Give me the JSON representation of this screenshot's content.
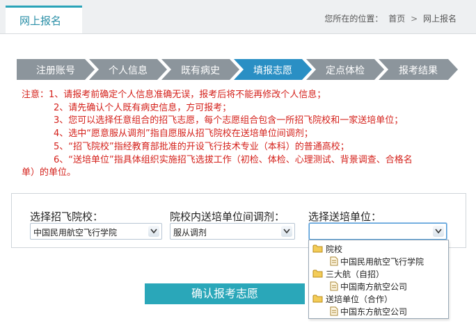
{
  "header": {
    "tab_title": "网上报名",
    "breadcrumb": {
      "prefix": "您所在的位置：",
      "items": [
        "首页",
        "网上报名"
      ],
      "separator": ">"
    }
  },
  "steps": [
    {
      "label": "注册账号",
      "active": false
    },
    {
      "label": "个人信息",
      "active": false
    },
    {
      "label": "既有病史",
      "active": false
    },
    {
      "label": "填报志愿",
      "active": true
    },
    {
      "label": "定点体检",
      "active": false
    },
    {
      "label": "报考结果",
      "active": false
    }
  ],
  "notes": {
    "prefix": "注意：",
    "items": [
      "1、请报考前确定个人信息准确无误，报考后将不能再修改个人信息；",
      "2、请先确认个人既有病史信息，方可报考；",
      "3、您可以选择任意组合的招飞志愿，每个志愿组合包含一所招飞院校和一家送培单位；",
      "4、选中“愿意服从调剂”指自愿服从招飞院校在送培单位间调剂；",
      "5、“招飞院校”指经教育部批准的开设飞行技术专业（本科）的普通高校；",
      "6、“送培单位”指具体组织实施招飞选拔工作（初检、体检、心理测试、背景调查、合格名"
    ],
    "continuation": "单）的单位。"
  },
  "form": {
    "school": {
      "label": "选择招飞院校：",
      "value": "中国民用航空飞行学院"
    },
    "adjust": {
      "label": "院校内送培单位间调剂：",
      "value": "服从调剂"
    },
    "unit": {
      "label": "选择送培单位：",
      "value": ""
    }
  },
  "dropdown": {
    "groups": [
      {
        "name": "院校",
        "items": [
          "中国民用航空飞行学院"
        ]
      },
      {
        "name": "三大航（自招）",
        "items": [
          "中国南方航空公司"
        ]
      },
      {
        "name": "送培单位（合作）",
        "items": [
          "中国东方航空公司"
        ]
      }
    ]
  },
  "confirm_label": "确认报考志愿",
  "colors": {
    "accent": "#29a3b8",
    "step_inactive": "#8c959c",
    "step_active": "#2a8fc4",
    "note_text": "#d4201a",
    "button": "#2aa7b9"
  }
}
